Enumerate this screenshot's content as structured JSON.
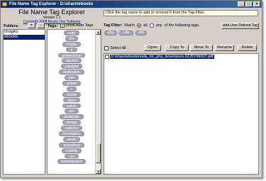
{
  "window": {
    "title": "File Name Tag Explorer - D:\\share\\ebooks",
    "minimize": "_",
    "maximize": "□",
    "close": "×"
  },
  "header": {
    "app_name": "File Name Tag Explorer",
    "version": "Version 1.1",
    "copyright": "Copyright 2008 Bearly Use Software"
  },
  "hint": "Click the tag name to add or remove it from the Tag Filter.",
  "folders": {
    "label": "Folders:",
    "add": "+",
    "remove": "-",
    "items": [
      "images",
      "ebooks"
    ],
    "selected_index": 1
  },
  "tags": {
    "label": "Tags:",
    "show_auto_label": "Show Auto Tags",
    "show_auto_checked": true,
    "items": [
      "ruby",
      "8th",
      "frontia",
      "tr",
      "professional",
      "second",
      "yukaghir",
      "application",
      "jam",
      "goblet",
      "r",
      "phone",
      "open",
      "admin",
      "pro",
      "javascript",
      "design",
      "patterns",
      "developers",
      "wrote",
      "unleashed",
      "mobility",
      "css",
      "development"
    ]
  },
  "tag_filter": {
    "label": "Tag Filter:",
    "match_label": "Match",
    "all_label": "all",
    "any_label": "any",
    "suffix": "of the following tags.",
    "mode": "all",
    "add_user_tag": "Add User Defined Tag",
    "active_tags": [
      "php",
      "rails",
      "pdf"
    ]
  },
  "actions": {
    "select_all": "Select All",
    "open": "Open",
    "copy_to": "Copy To",
    "move_to": "Move To",
    "rename": "Rename",
    "delete": "Delete"
  },
  "files": [
    {
      "name": "D:\\share\\ebooks\\rails_for_php_developers.6125749007.pdf",
      "checked": false,
      "selected": true
    }
  ]
}
